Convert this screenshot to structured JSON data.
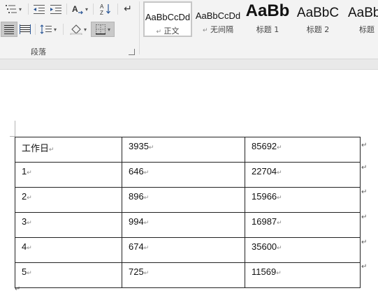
{
  "ribbon": {
    "paragraph_group_label": "段落",
    "styles": [
      {
        "sample": "AaBbCcDd",
        "name": "正文",
        "selected": true
      },
      {
        "sample": "AaBbCcDd",
        "name": "无间隔",
        "selected": false
      },
      {
        "sample": "AaBb",
        "name": "标题 1",
        "selected": false
      },
      {
        "sample": "AaBbC",
        "name": "标题 2",
        "selected": false
      },
      {
        "sample": "AaBb",
        "name": "标题",
        "selected": false
      }
    ],
    "paragraph_mark": "↵"
  },
  "table": {
    "rows": [
      [
        "工作日",
        "3935",
        "85692"
      ],
      [
        "1",
        "646",
        "22704"
      ],
      [
        "2",
        "896",
        "15966"
      ],
      [
        "3",
        "994",
        "16987"
      ],
      [
        "4",
        "674",
        "35600"
      ],
      [
        "5",
        "725",
        "11569"
      ]
    ]
  },
  "colors": {
    "ribbon_bg": "#f3f3f3",
    "pressed_button": "#c9c9c9",
    "table_border": "#222222"
  }
}
